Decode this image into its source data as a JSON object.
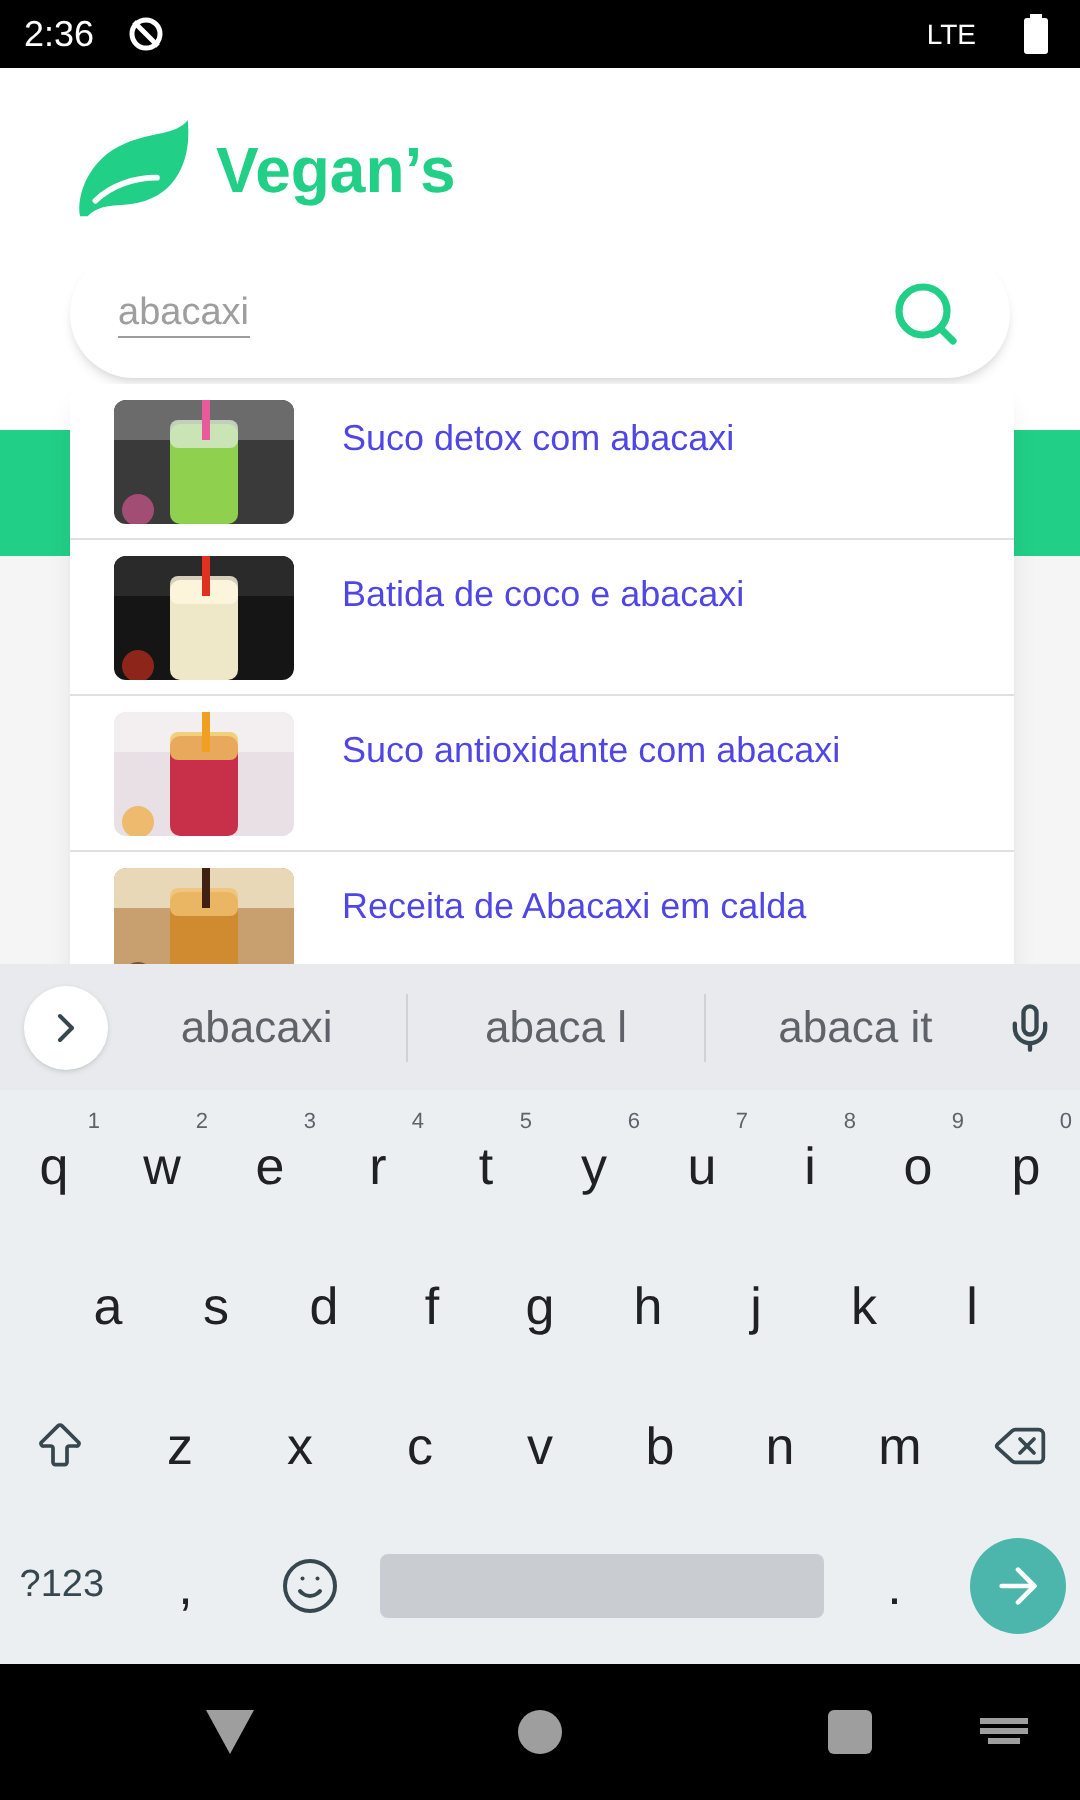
{
  "status_bar": {
    "time": "2:36",
    "network": "LTE"
  },
  "app": {
    "title": "Vegan’s"
  },
  "search": {
    "value": "abacaxi"
  },
  "results": [
    {
      "title": "Suco detox com abacaxi"
    },
    {
      "title": "Batida de coco e abacaxi"
    },
    {
      "title": "Suco antioxidante com abacaxi"
    },
    {
      "title": "Receita de Abacaxi em calda"
    }
  ],
  "keyboard": {
    "suggestions": [
      "abacaxi",
      "abaca l",
      "abaca it"
    ],
    "rows": [
      [
        {
          "kind": "letter",
          "label": "q",
          "hint": "1"
        },
        {
          "kind": "letter",
          "label": "w",
          "hint": "2"
        },
        {
          "kind": "letter",
          "label": "e",
          "hint": "3"
        },
        {
          "kind": "letter",
          "label": "r",
          "hint": "4"
        },
        {
          "kind": "letter",
          "label": "t",
          "hint": "5"
        },
        {
          "kind": "letter",
          "label": "y",
          "hint": "6"
        },
        {
          "kind": "letter",
          "label": "u",
          "hint": "7"
        },
        {
          "kind": "letter",
          "label": "i",
          "hint": "8"
        },
        {
          "kind": "letter",
          "label": "o",
          "hint": "9"
        },
        {
          "kind": "letter",
          "label": "p",
          "hint": "0"
        }
      ],
      [
        {
          "kind": "letter",
          "label": "a"
        },
        {
          "kind": "letter",
          "label": "s"
        },
        {
          "kind": "letter",
          "label": "d"
        },
        {
          "kind": "letter",
          "label": "f"
        },
        {
          "kind": "letter",
          "label": "g"
        },
        {
          "kind": "letter",
          "label": "h"
        },
        {
          "kind": "letter",
          "label": "j"
        },
        {
          "kind": "letter",
          "label": "k"
        },
        {
          "kind": "letter",
          "label": "l"
        }
      ],
      [
        {
          "kind": "shift"
        },
        {
          "kind": "letter",
          "label": "z"
        },
        {
          "kind": "letter",
          "label": "x"
        },
        {
          "kind": "letter",
          "label": "c"
        },
        {
          "kind": "letter",
          "label": "v"
        },
        {
          "kind": "letter",
          "label": "b"
        },
        {
          "kind": "letter",
          "label": "n"
        },
        {
          "kind": "letter",
          "label": "m"
        },
        {
          "kind": "backspace"
        }
      ],
      [
        {
          "kind": "symbols",
          "label": "?123"
        },
        {
          "kind": "letter",
          "label": ","
        },
        {
          "kind": "emoji"
        },
        {
          "kind": "space"
        },
        {
          "kind": "letter",
          "label": "."
        },
        {
          "kind": "enter"
        }
      ]
    ]
  }
}
